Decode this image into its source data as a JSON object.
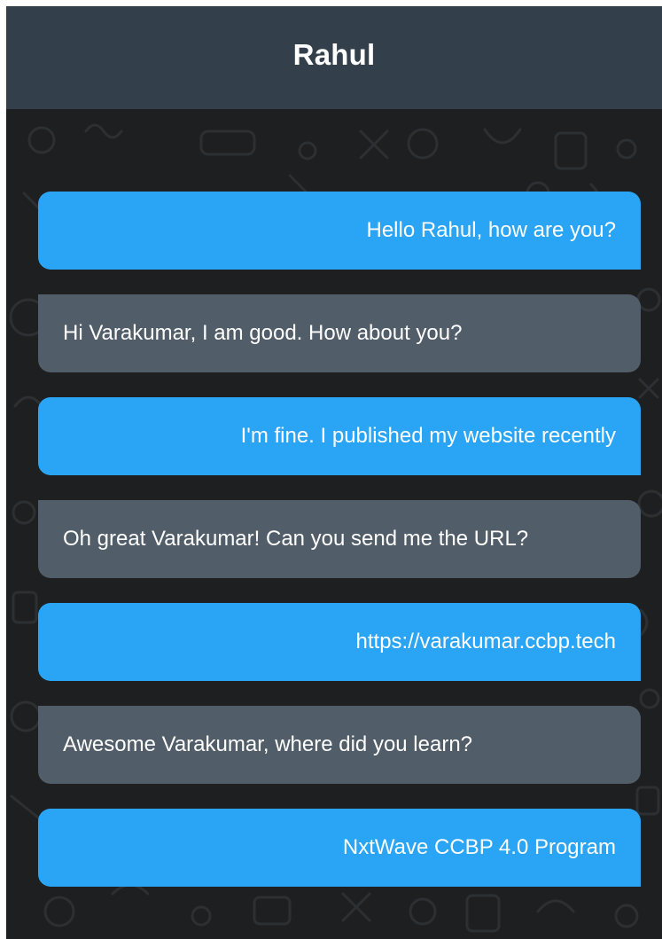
{
  "header": {
    "contact_name": "Rahul"
  },
  "colors": {
    "header_bg": "#333f4b",
    "chat_bg": "#1d1f21",
    "sent_bubble": "#2aa4f4",
    "received_bubble": "#515d68",
    "text": "#ffffff"
  },
  "messages": [
    {
      "direction": "sent",
      "text": "Hello Rahul, how are you?"
    },
    {
      "direction": "received",
      "text": "Hi Varakumar, I am good. How about you?"
    },
    {
      "direction": "sent",
      "text": "I'm fine. I published my website recently"
    },
    {
      "direction": "received",
      "text": "Oh great Varakumar! Can you send me the URL?"
    },
    {
      "direction": "sent",
      "text": "https://varakumar.ccbp.tech"
    },
    {
      "direction": "received",
      "text": "Awesome Varakumar, where did you learn?"
    },
    {
      "direction": "sent",
      "text": "NxtWave CCBP 4.0 Program"
    }
  ]
}
